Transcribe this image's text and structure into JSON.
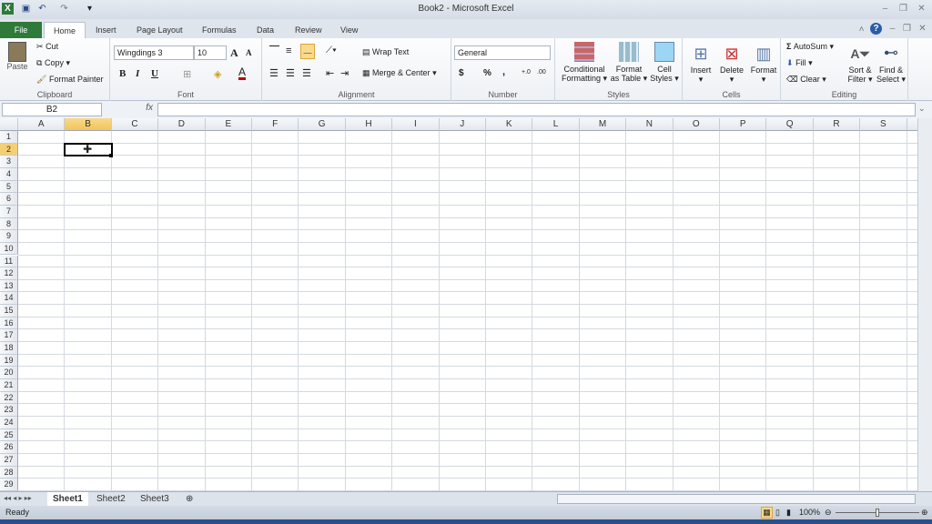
{
  "window": {
    "title": "Book2 - Microsoft Excel",
    "controls": [
      "minimize",
      "restore",
      "close"
    ]
  },
  "quick_access": [
    "excel-logo-icon",
    "save-icon",
    "undo-icon",
    "redo-icon",
    "customize-icon"
  ],
  "tabs": [
    {
      "label": "File"
    },
    {
      "label": "Home",
      "active": true
    },
    {
      "label": "Insert"
    },
    {
      "label": "Page Layout"
    },
    {
      "label": "Formulas"
    },
    {
      "label": "Data"
    },
    {
      "label": "Review"
    },
    {
      "label": "View"
    }
  ],
  "ribbon": {
    "clipboard": {
      "label": "Clipboard",
      "paste": "Paste",
      "cut": "Cut",
      "copy": "Copy",
      "format_painter": "Format Painter"
    },
    "font": {
      "label": "Font",
      "font_name": "Wingdings 3",
      "font_size": "10",
      "bold": "B",
      "italic": "I",
      "underline": "U",
      "grow": "A",
      "shrink": "A",
      "font_color": "A",
      "font_color_hex": "#c00000"
    },
    "alignment": {
      "label": "Alignment",
      "wrap_text": "Wrap Text",
      "merge_center": "Merge & Center"
    },
    "number": {
      "label": "Number",
      "format": "General",
      "currency": "$",
      "percent": "%",
      "comma": ",",
      "inc_decimal": "+.0",
      "dec_decimal": ".00"
    },
    "styles": {
      "label": "Styles",
      "conditional_1": "Conditional",
      "conditional_2": "Formatting",
      "format_table_1": "Format",
      "format_table_2": "as Table",
      "cell_styles_1": "Cell",
      "cell_styles_2": "Styles"
    },
    "cells": {
      "label": "Cells",
      "insert": "Insert",
      "delete": "Delete",
      "format": "Format"
    },
    "editing": {
      "label": "Editing",
      "autosum": "AutoSum",
      "fill": "Fill",
      "clear": "Clear",
      "sort_1": "Sort &",
      "sort_2": "Filter",
      "find_1": "Find &",
      "find_2": "Select"
    }
  },
  "formula_bar": {
    "name_box": "B2",
    "fx": "fx",
    "value": ""
  },
  "grid": {
    "columns": [
      "A",
      "B",
      "C",
      "D",
      "E",
      "F",
      "G",
      "H",
      "I",
      "J",
      "K",
      "L",
      "M",
      "N",
      "O",
      "P",
      "Q",
      "R",
      "S"
    ],
    "rows": 29,
    "selected_cell": "B2",
    "selected_column": "B",
    "selected_row": 2,
    "highlight_color": "#f5cf73"
  },
  "sheets": [
    {
      "label": "Sheet1",
      "active": true
    },
    {
      "label": "Sheet2"
    },
    {
      "label": "Sheet3"
    }
  ],
  "status": {
    "text": "Ready",
    "zoom": "100%"
  }
}
